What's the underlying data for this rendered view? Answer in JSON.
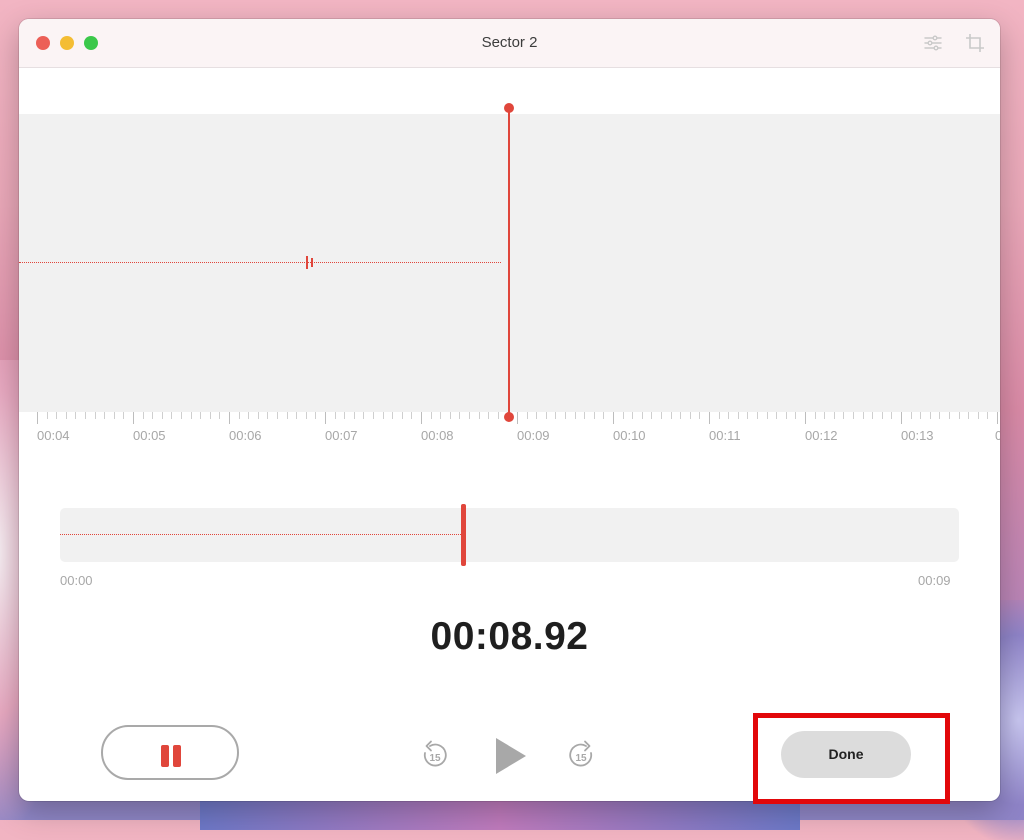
{
  "window": {
    "title": "Sector 2"
  },
  "toolbar": {
    "settings_icon": "sliders-icon",
    "trim_icon": "crop-icon"
  },
  "timeline": {
    "labels": [
      "00:04",
      "00:05",
      "00:06",
      "00:07",
      "00:08",
      "00:09",
      "00:10",
      "00:11",
      "00:12",
      "00:13"
    ],
    "overflow_label": "0"
  },
  "scrubber": {
    "start": "00:00",
    "end": "00:09",
    "progress": 0.446
  },
  "elapsed": "00:08.92",
  "controls": {
    "pause_icon": "pause-icon",
    "skip_back": "15",
    "skip_forward": "15",
    "play_icon": "play-icon",
    "done_label": "Done"
  },
  "colors": {
    "accent": "#e0463b",
    "highlight": "#e2070a"
  }
}
